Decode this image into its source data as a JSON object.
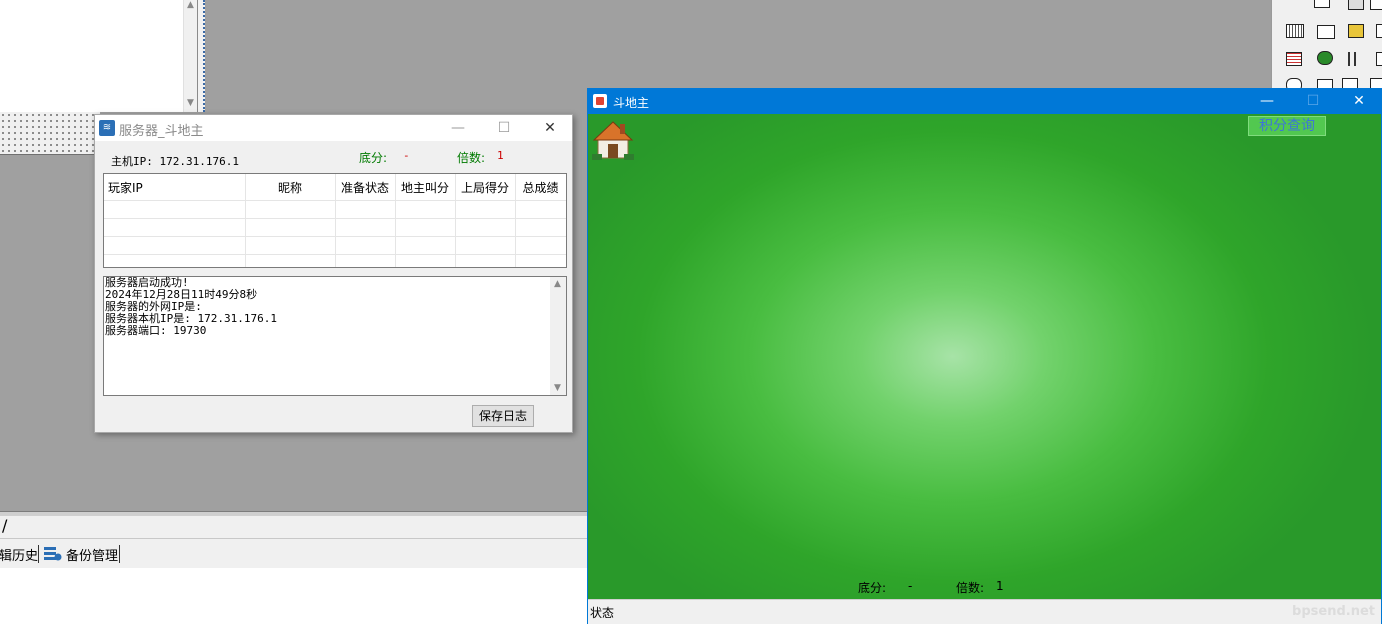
{
  "ide": {
    "slash": "/",
    "tabs": [
      {
        "label": "编辑历史",
        "visible_text": "辑历史"
      },
      {
        "label": "备份管理"
      }
    ]
  },
  "server_window": {
    "title": "服务器_斗地主",
    "host_ip_label": "主机IP: 172.31.176.1",
    "base_score_label": "底分:",
    "base_score_value": "-",
    "multiplier_label": "倍数:",
    "multiplier_value": "1",
    "table_headers": [
      "玩家IP",
      "昵称",
      "准备状态",
      "地主叫分",
      "上局得分",
      "总成绩"
    ],
    "log_lines": [
      "服务器启动成功!",
      "2024年12月28日11时49分8秒",
      "服务器的外网IP是:",
      "服务器本机IP是: 172.31.176.1",
      "服务器端口: 19730"
    ],
    "save_log_button": "保存日志",
    "colors": {
      "label_green": "#007a00",
      "value_red": "#cc0000"
    }
  },
  "game_window": {
    "title": "斗地主",
    "score_query_button": "积分查询",
    "base_score_label": "底分:",
    "base_score_value": "-",
    "multiplier_label": "倍数:",
    "multiplier_value": "1",
    "status_label": "状态",
    "watermark": "bpsend.net",
    "colors": {
      "title_bar": "#0078d7",
      "table_green": "#2fa52a"
    }
  },
  "caption_glyphs": {
    "minimize": "—",
    "maximize": "☐",
    "close": "✕"
  }
}
